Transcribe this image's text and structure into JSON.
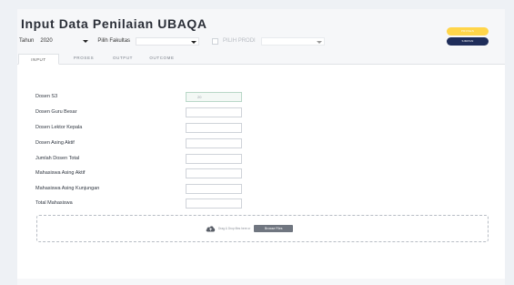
{
  "header": {
    "title": "Input Data Penilaian UBAQA"
  },
  "filters": {
    "year_label": "Tahun",
    "year_value": "2020",
    "fakultas_placeholder": "Pilih Fakultas",
    "prodi_placeholder": "PILIH PRODI"
  },
  "actions": {
    "primary_label": "PROSES",
    "save_label": "SIMPAN",
    "colors": {
      "primary": "#ffd54a",
      "save": "#1f2d5a"
    }
  },
  "tabs": [
    {
      "label": "INPUT",
      "active": true
    },
    {
      "label": "PROSES",
      "active": false
    },
    {
      "label": "OUTPUT",
      "active": false
    },
    {
      "label": "OUTCOME",
      "active": false
    }
  ],
  "form": {
    "fields": [
      {
        "label": "Dosen S3",
        "value": "20"
      },
      {
        "label": "Dosen Guru Besar",
        "value": ""
      },
      {
        "label": "Dosen Lektor Kepala",
        "value": ""
      },
      {
        "label": "Dosen Asing Aktif",
        "value": ""
      },
      {
        "label": "Jumlah Dosen Total",
        "value": ""
      },
      {
        "label": "Mahasiswa Asing Aktif",
        "value": ""
      },
      {
        "label": "Mahasiswa Asing Kunjungan",
        "value": ""
      },
      {
        "label": "Total Mahasiswa",
        "value": ""
      }
    ]
  },
  "upload": {
    "icon": "cloud-upload-icon",
    "drop_text": "Drag & Drop files here or",
    "browse_label": "Browse Files"
  }
}
